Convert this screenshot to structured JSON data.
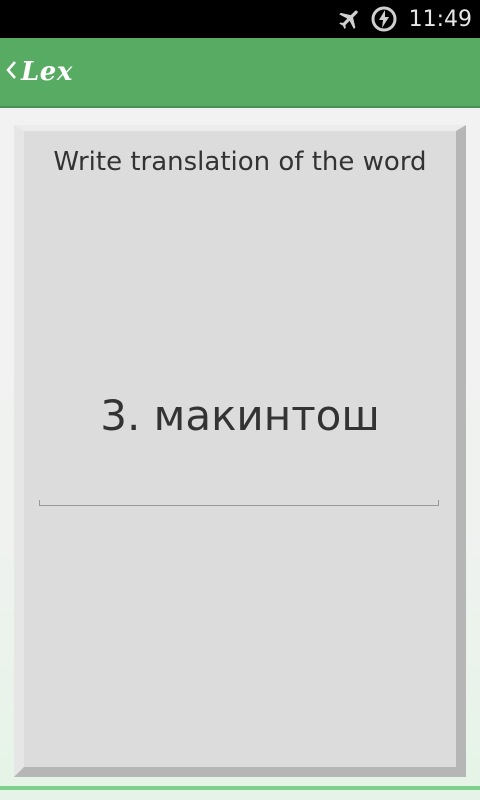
{
  "status_bar": {
    "time": "11:49",
    "icons": [
      "airplane-mode-icon",
      "charging-battery-icon"
    ]
  },
  "action_bar": {
    "title": "Lex",
    "color": "#58ab63",
    "back_icon": "chevron-left-icon"
  },
  "card": {
    "prompt": "Write translation of the word",
    "word": "3. макинтош",
    "answer_value": ""
  }
}
